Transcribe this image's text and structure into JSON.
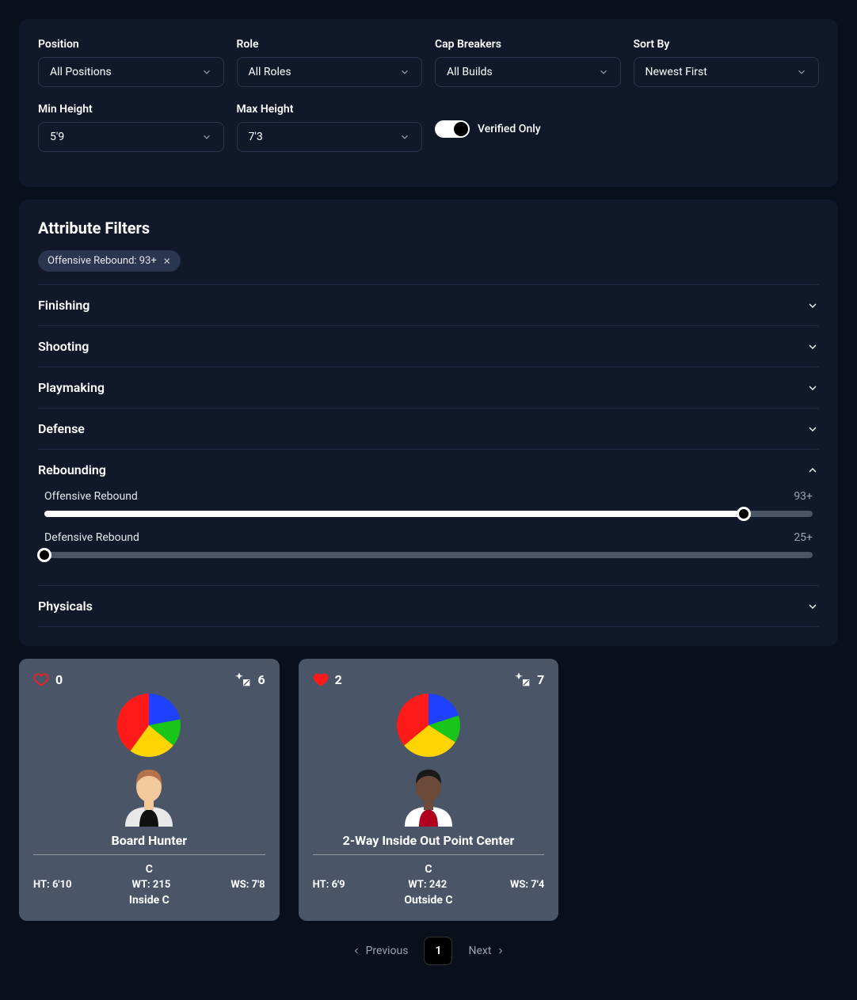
{
  "filters": {
    "position": {
      "label": "Position",
      "value": "All Positions"
    },
    "role": {
      "label": "Role",
      "value": "All Roles"
    },
    "capBreakers": {
      "label": "Cap Breakers",
      "value": "All Builds"
    },
    "sortBy": {
      "label": "Sort By",
      "value": "Newest First"
    },
    "minHeight": {
      "label": "Min Height",
      "value": "5'9"
    },
    "maxHeight": {
      "label": "Max Height",
      "value": "7'3"
    },
    "verifiedOnly": {
      "label": "Verified Only",
      "on": true
    }
  },
  "attributeFilters": {
    "title": "Attribute Filters",
    "chips": [
      {
        "label": "Offensive Rebound: 93+"
      }
    ],
    "groups": [
      {
        "name": "Finishing",
        "open": false
      },
      {
        "name": "Shooting",
        "open": false
      },
      {
        "name": "Playmaking",
        "open": false
      },
      {
        "name": "Defense",
        "open": false
      },
      {
        "name": "Rebounding",
        "open": true,
        "sliders": [
          {
            "label": "Offensive Rebound",
            "value": "93+",
            "percent": 91
          },
          {
            "label": "Defensive Rebound",
            "value": "25+",
            "percent": 0
          }
        ]
      },
      {
        "name": "Physicals",
        "open": false
      }
    ]
  },
  "builds": [
    {
      "likes": 0,
      "liked": false,
      "capBreakers": 6,
      "pie": [
        {
          "color": "#1e40ff",
          "pct": 22
        },
        {
          "color": "#18c618",
          "pct": 14
        },
        {
          "color": "#ffd400",
          "pct": 24
        },
        {
          "color": "#ff1a1a",
          "pct": 40
        }
      ],
      "name": "Board Hunter",
      "position": "C",
      "height": "HT: 6'10",
      "weight": "WT: 215",
      "wingspan": "WS: 7'8",
      "role": "Inside C",
      "avatar": {
        "skin": "#f2c99b",
        "hair": "#b5734a",
        "jersey1": "#e8e8e8",
        "jersey2": "#111"
      }
    },
    {
      "likes": 2,
      "liked": true,
      "capBreakers": 7,
      "pie": [
        {
          "color": "#1e40ff",
          "pct": 20
        },
        {
          "color": "#18c618",
          "pct": 14
        },
        {
          "color": "#ffd400",
          "pct": 30
        },
        {
          "color": "#ff1a1a",
          "pct": 36
        }
      ],
      "name": "2-Way Inside Out Point Center",
      "position": "C",
      "height": "HT: 6'9",
      "weight": "WT: 242",
      "wingspan": "WS: 7'4",
      "role": "Outside C",
      "avatar": {
        "skin": "#6b4a3a",
        "hair": "#1a1a1a",
        "jersey1": "#fff",
        "jersey2": "#b00020"
      }
    }
  ],
  "pagination": {
    "previous": "Previous",
    "next": "Next",
    "current": "1"
  }
}
